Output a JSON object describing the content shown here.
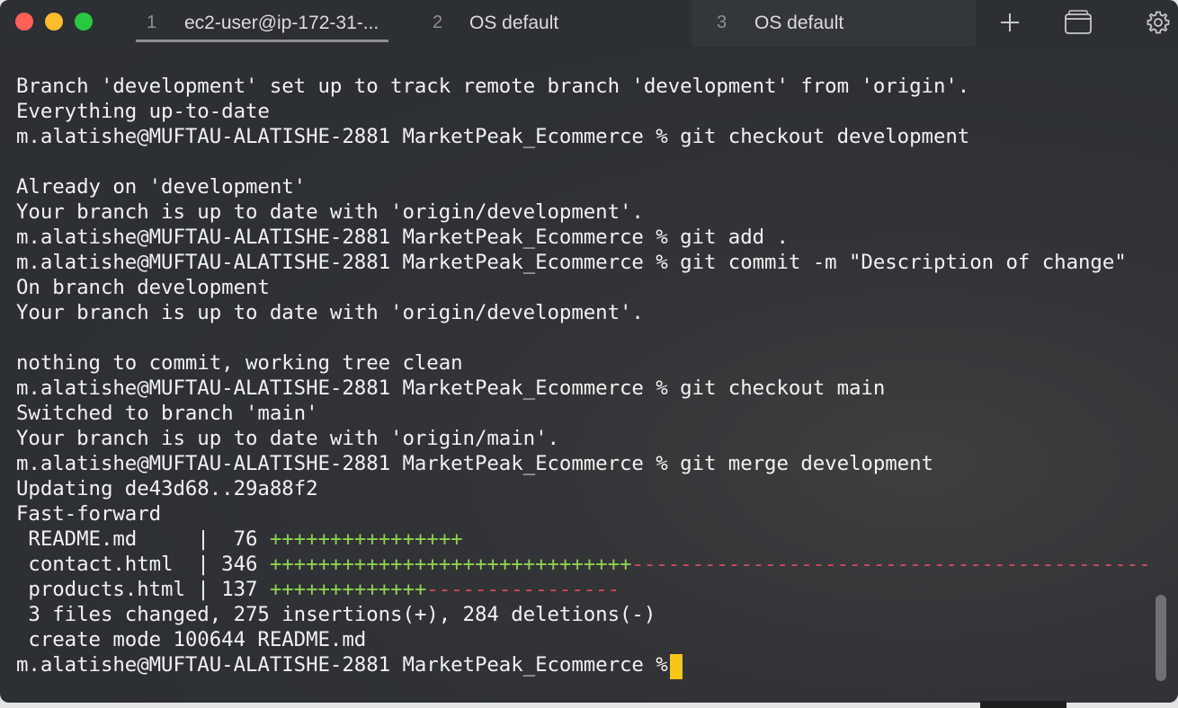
{
  "window": {
    "controls": {
      "close": "#fe5f57",
      "minimize": "#febc2e",
      "zoom": "#28c840"
    }
  },
  "tabs": [
    {
      "number": "1",
      "title": "ec2-user@ip-172-31-...",
      "active": true
    },
    {
      "number": "2",
      "title": "OS default",
      "active": false
    },
    {
      "number": "3",
      "title": "OS default",
      "active": false
    }
  ],
  "toolbar_icons": [
    "plus-icon",
    "tabs-overview-icon",
    "gear-icon"
  ],
  "terminal": {
    "lines": [
      "Branch 'development' set up to track remote branch 'development' from 'origin'.",
      "Everything up-to-date",
      "m.alatishe@MUFTAU-ALATISHE-2881 MarketPeak_Ecommerce % git checkout development",
      "",
      "Already on 'development'",
      "Your branch is up to date with 'origin/development'.",
      "m.alatishe@MUFTAU-ALATISHE-2881 MarketPeak_Ecommerce % git add .",
      "m.alatishe@MUFTAU-ALATISHE-2881 MarketPeak_Ecommerce % git commit -m \"Description of change\"",
      "On branch development",
      "Your branch is up to date with 'origin/development'.",
      "",
      "nothing to commit, working tree clean",
      "m.alatishe@MUFTAU-ALATISHE-2881 MarketPeak_Ecommerce % git checkout main",
      "Switched to branch 'main'",
      "Your branch is up to date with 'origin/main'.",
      "m.alatishe@MUFTAU-ALATISHE-2881 MarketPeak_Ecommerce % git merge development",
      "Updating de43d68..29a88f2",
      "Fast-forward"
    ],
    "diffstat": [
      {
        "prefix": " README.md     |  76 ",
        "plus": "++++++++++++++++",
        "minus": ""
      },
      {
        "prefix": " contact.html  | 346 ",
        "plus": "++++++++++++++++++++++++++++++",
        "minus": "-------------------------------------------"
      },
      {
        "prefix": " products.html | 137 ",
        "plus": "+++++++++++++",
        "minus": "----------------"
      }
    ],
    "summary_lines": [
      " 3 files changed, 275 insertions(+), 284 deletions(-)",
      " create mode 100644 README.md"
    ],
    "prompt": "m.alatishe@MUFTAU-ALATISHE-2881 MarketPeak_Ecommerce % ",
    "colors": {
      "insertions": "#8fd14f",
      "deletions": "#d84a5c",
      "cursor": "#f5c518",
      "text": "#f2f2f2"
    }
  }
}
